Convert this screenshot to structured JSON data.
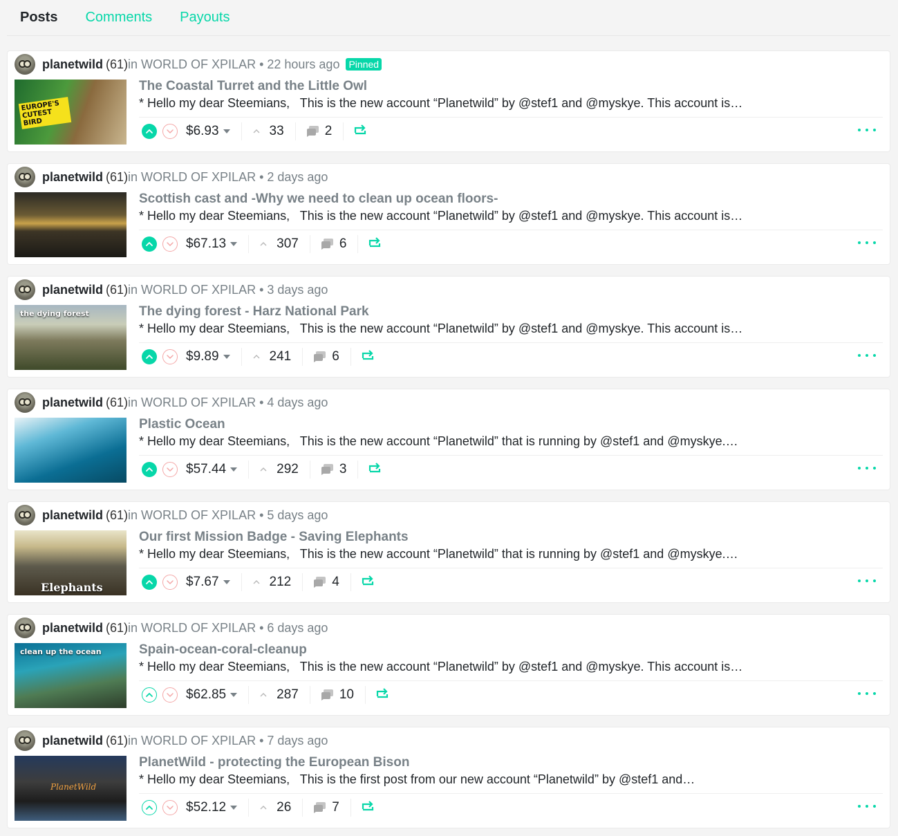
{
  "tabs": [
    {
      "label": "Posts"
    },
    {
      "label": "Comments"
    },
    {
      "label": "Payouts"
    }
  ],
  "posts": [
    {
      "author": "planetwild",
      "rep": "(61)",
      "meta": "in WORLD OF XPILAR • 22 hours ago",
      "pinned": "Pinned",
      "title": "The Coastal Turret and the Little Owl",
      "summary": "* Hello my dear Steemians,   This is the new account “Planetwild” by @stef1 and @myskye. This account is…",
      "payout": "$6.93",
      "votes": "33",
      "comments": "2",
      "upvoted": true,
      "thumb_text": "EUROPE'S CUTEST BIRD"
    },
    {
      "author": "planetwild",
      "rep": "(61)",
      "meta": "in WORLD OF XPILAR • 2 days ago",
      "title": "Scottish cast and -Why we need to clean up ocean floors-",
      "summary": "* Hello my dear Steemians,   This is the new account “Planetwild” by @stef1 and @myskye. This account is…",
      "payout": "$67.13",
      "votes": "307",
      "comments": "6",
      "upvoted": true
    },
    {
      "author": "planetwild",
      "rep": "(61)",
      "meta": "in WORLD OF XPILAR • 3 days ago",
      "title": "The dying forest - Harz National Park",
      "summary": "* Hello my dear Steemians,   This is the new account “Planetwild” by @stef1 and @myskye. This account is…",
      "payout": "$9.89",
      "votes": "241",
      "comments": "6",
      "upvoted": true,
      "thumb_text": "the dying forest"
    },
    {
      "author": "planetwild",
      "rep": "(61)",
      "meta": "in WORLD OF XPILAR • 4 days ago",
      "title": "Plastic Ocean",
      "summary": "* Hello my dear Steemians,   This is the new account “Planetwild” that is running by @stef1 and @myskye.…",
      "payout": "$57.44",
      "votes": "292",
      "comments": "3",
      "upvoted": true
    },
    {
      "author": "planetwild",
      "rep": "(61)",
      "meta": "in WORLD OF XPILAR • 5 days ago",
      "title": "Our first Mission Badge - Saving Elephants",
      "summary": "* Hello my dear Steemians,   This is the new account “Planetwild” that is running by @stef1 and @myskye.…",
      "payout": "$7.67",
      "votes": "212",
      "comments": "4",
      "upvoted": true,
      "thumb_text": "Elephants"
    },
    {
      "author": "planetwild",
      "rep": "(61)",
      "meta": "in WORLD OF XPILAR • 6 days ago",
      "title": "Spain-ocean-coral-cleanup",
      "summary": "* Hello my dear Steemians,   This is the new account “Planetwild” by @stef1 and @myskye. This account is…",
      "payout": "$62.85",
      "votes": "287",
      "comments": "10",
      "upvoted": false,
      "thumb_text": "clean up the ocean"
    },
    {
      "author": "planetwild",
      "rep": "(61)",
      "meta": "in WORLD OF XPILAR • 7 days ago",
      "title": "PlanetWild - protecting the European Bison",
      "summary": "* Hello my dear Steemians,   This is the first post from our new account “Planetwild” by @stef1 and…",
      "payout": "$52.12",
      "votes": "26",
      "comments": "7",
      "upvoted": false,
      "thumb_text": "PlanetWild"
    }
  ],
  "colors": {
    "accent": "#07d7a9",
    "downvote": "#f4a7a7",
    "meta": "#788187"
  }
}
